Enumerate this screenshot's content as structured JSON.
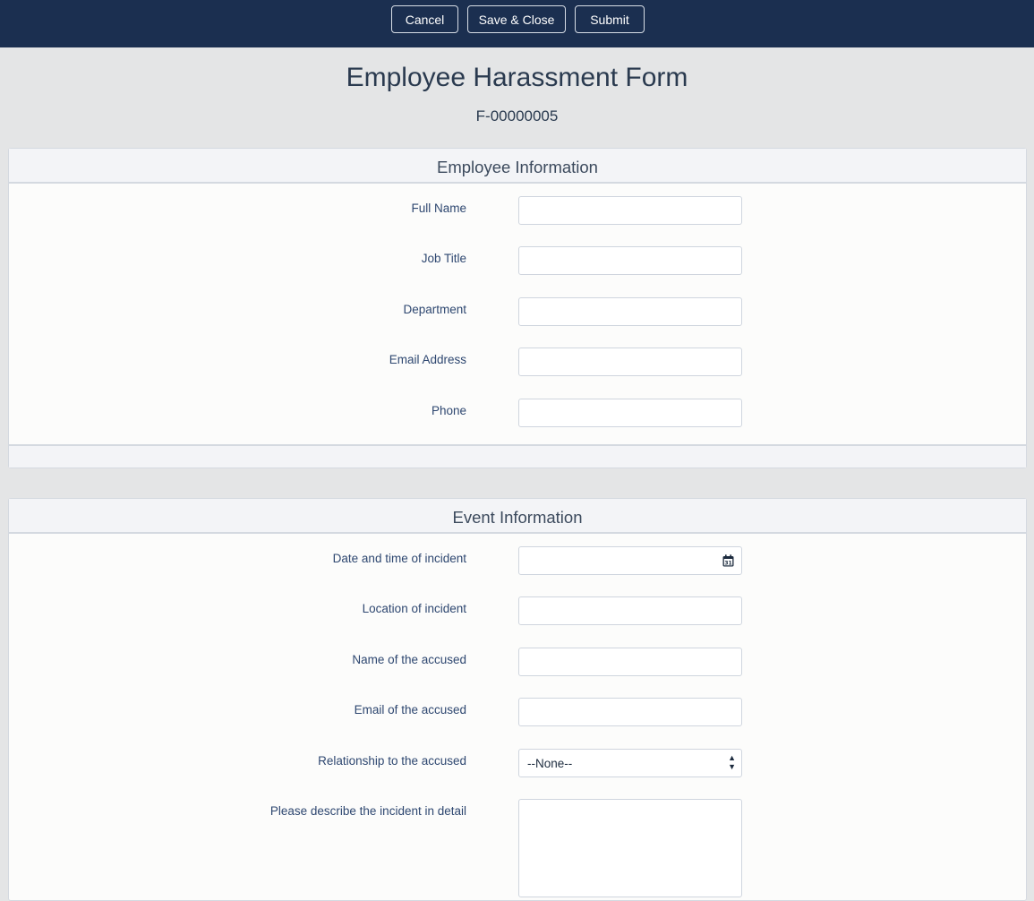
{
  "toolbar": {
    "cancel_label": "Cancel",
    "save_close_label": "Save & Close",
    "submit_label": "Submit"
  },
  "header": {
    "title": "Employee Harassment Form",
    "record_id": "F-00000005"
  },
  "employee_section": {
    "heading": "Employee Information",
    "fields": [
      {
        "label": "Full Name",
        "value": ""
      },
      {
        "label": "Job Title",
        "value": ""
      },
      {
        "label": "Department",
        "value": ""
      },
      {
        "label": "Email Address",
        "value": ""
      },
      {
        "label": "Phone",
        "value": ""
      }
    ]
  },
  "event_section": {
    "heading": "Event Information",
    "fields": [
      {
        "label": "Date and time of incident",
        "value": "",
        "icon": "calendar-icon"
      },
      {
        "label": "Location of incident",
        "value": ""
      },
      {
        "label": "Name of the accused",
        "value": ""
      },
      {
        "label": "Email of the accused",
        "value": ""
      },
      {
        "label": "Relationship to the accused",
        "value": "--None--"
      },
      {
        "label": "Please describe the incident in detail",
        "value": ""
      }
    ]
  },
  "colors": {
    "topbar": "#1b2f50",
    "page_background": "#e4e5e6",
    "label_text": "#2e4770"
  }
}
